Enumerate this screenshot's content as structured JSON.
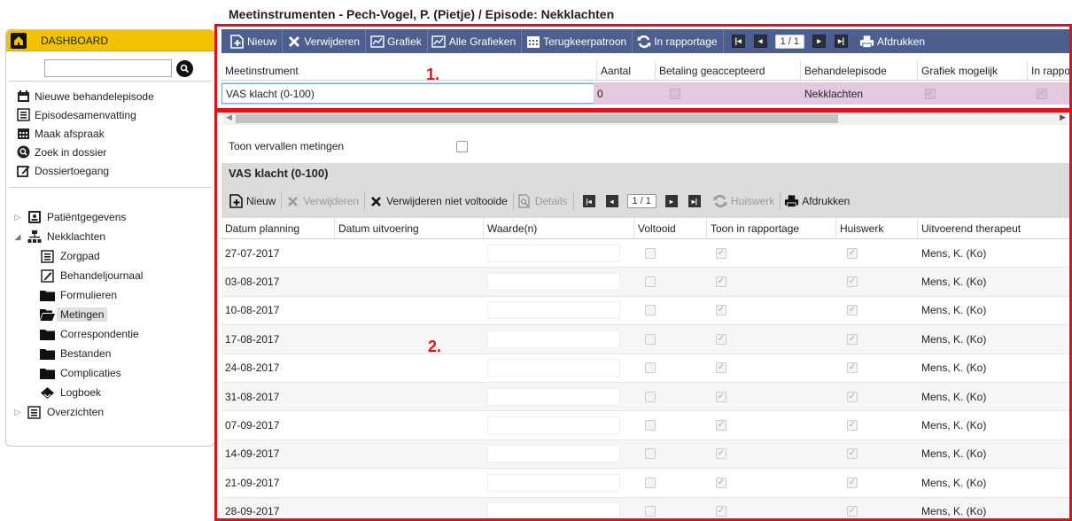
{
  "page_title": "Meetinstrumenten - Pech-Vogel, P. (Pietje) / Episode: Nekklachten",
  "sidebar": {
    "dashboard_label": "DASHBOARD",
    "search_value": "",
    "quick_items": [
      {
        "label": "Nieuwe behandelepisode",
        "icon": "calendar-add-icon"
      },
      {
        "label": "Episodesamenvatting",
        "icon": "list-icon"
      },
      {
        "label": "Maak afspraak",
        "icon": "calendar-icon"
      },
      {
        "label": "Zoek in dossier",
        "icon": "search-icon"
      },
      {
        "label": "Dossiertoegang",
        "icon": "edit-icon"
      }
    ],
    "tree": {
      "patient": "Patiëntgegevens",
      "episode": "Nekklachten",
      "children": [
        "Zorgpad",
        "Behandeljournaal",
        "Formulieren",
        "Metingen",
        "Correspondentie",
        "Bestanden",
        "Complicaties",
        "Logboek"
      ],
      "selected": "Metingen",
      "overviews": "Overzichten"
    }
  },
  "toolbar1": {
    "new": "Nieuw",
    "delete": "Verwijderen",
    "chart": "Grafiek",
    "all_charts": "Alle Grafieken",
    "recurring": "Terugkeerpatroon",
    "in_report": "In rapportage",
    "page": "1 / 1",
    "print": "Afdrukken"
  },
  "grid1": {
    "headers": [
      "Meetinstrument",
      "Aantal",
      "Betaling geaccepteerd",
      "Behandelepisode",
      "Grafiek mogelijk",
      "In rappo"
    ],
    "row": {
      "meetinstrument": "VAS klacht (0-100)",
      "aantal": "0",
      "betaling": false,
      "behandelepisode": "Nekklachten",
      "grafiek": true,
      "in_rapportage": true
    }
  },
  "annotations": {
    "one": "1.",
    "two": "2."
  },
  "vervallen_label": "Toon vervallen metingen",
  "section": {
    "title": "VAS klacht (0-100)",
    "toolbar": {
      "new": "Nieuw",
      "delete": "Verwijderen",
      "delete_incomplete": "Verwijderen niet voltooide",
      "details": "Details",
      "page": "1 / 1",
      "homework": "Huiswerk",
      "print": "Afdrukken"
    }
  },
  "grid2": {
    "headers": [
      "Datum planning",
      "Datum uitvoering",
      "Waarde(n)",
      "Voltooid",
      "Toon in rapportage",
      "Huiswerk",
      "Uitvoerend therapeut"
    ],
    "rows": [
      {
        "planning": "27-07-2017",
        "uitvoering": "",
        "therapeut": "Mens, K. (Ko)"
      },
      {
        "planning": "03-08-2017",
        "uitvoering": "",
        "therapeut": "Mens, K. (Ko)"
      },
      {
        "planning": "10-08-2017",
        "uitvoering": "",
        "therapeut": "Mens, K. (Ko)"
      },
      {
        "planning": "17-08-2017",
        "uitvoering": "",
        "therapeut": "Mens, K. (Ko)"
      },
      {
        "planning": "24-08-2017",
        "uitvoering": "",
        "therapeut": "Mens, K. (Ko)"
      },
      {
        "planning": "31-08-2017",
        "uitvoering": "",
        "therapeut": "Mens, K. (Ko)"
      },
      {
        "planning": "07-09-2017",
        "uitvoering": "",
        "therapeut": "Mens, K. (Ko)"
      },
      {
        "planning": "14-09-2017",
        "uitvoering": "",
        "therapeut": "Mens, K. (Ko)"
      },
      {
        "planning": "21-09-2017",
        "uitvoering": "",
        "therapeut": "Mens, K. (Ko)"
      },
      {
        "planning": "28-09-2017",
        "uitvoering": "",
        "therapeut": "Mens, K. (Ko)"
      }
    ]
  },
  "colors": {
    "accent": "#f2c200",
    "toolbar": "#4d5f8e",
    "highlight": "#e3101c",
    "row_selected": "#e2c9e0"
  }
}
